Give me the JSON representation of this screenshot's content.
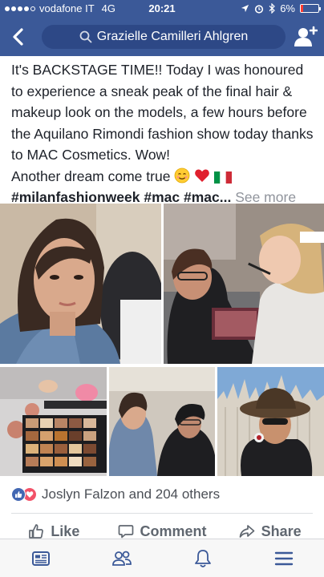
{
  "status_bar": {
    "carrier": "vodafone IT",
    "network": "4G",
    "time": "20:21",
    "battery": "6%"
  },
  "nav": {
    "title": "Grazielle Camilleri Ahlgren"
  },
  "post": {
    "line_1": "It's BACKSTAGE TIME!! Today I was honoured to experience a sneak peak of the final hair & makeup look on the models, a few hours before the Aquilano Rimondi fashion show today thanks to MAC Cosmetics. Wow!",
    "line_2": "Another dream come true",
    "hashtags": "#milanfashionweek #mac #mac...",
    "see_more": "See more"
  },
  "reactions": {
    "summary": "Joslyn Falzon and 204 others"
  },
  "actions": {
    "like": "Like",
    "comment": "Comment",
    "share": "Share"
  },
  "colors": {
    "brand": "#3b5998",
    "like": "#4267b2",
    "love": "#f25268"
  }
}
